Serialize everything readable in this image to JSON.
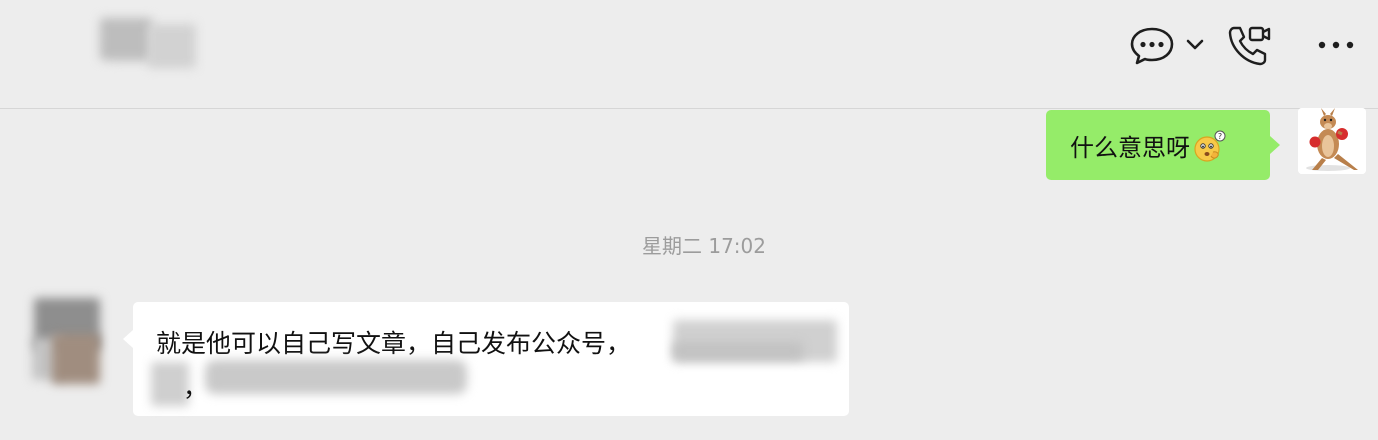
{
  "header": {
    "title": "",
    "icons": [
      "chat-options-icon",
      "chevron-down-icon",
      "video-call-icon",
      "more-icon"
    ]
  },
  "messages": {
    "outgoing_text": "什么意思呀",
    "outgoing_emoji": "thinking-emoji",
    "timestamp": "星期二 17:02",
    "incoming_text": "就是他可以自己写文章，自己发布公众号，",
    "incoming_text_2": "，"
  },
  "colors": {
    "background": "#ededed",
    "outgoing_bubble": "#95ec69",
    "incoming_bubble": "#ffffff",
    "timestamp": "#9c9c9c"
  }
}
